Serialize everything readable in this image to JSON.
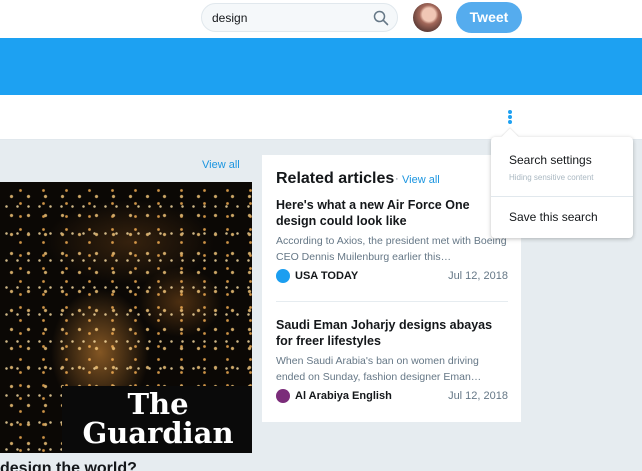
{
  "header": {
    "search_value": "design",
    "tweet_label": "Tweet"
  },
  "menu": {
    "search_settings": "Search settings",
    "search_settings_sub": "Hiding sensitive content",
    "save_search": "Save this search"
  },
  "left_card": {
    "view_all": "View all",
    "image_logo": "The Guardian",
    "headline": "design the world?"
  },
  "related": {
    "title": "Related articles",
    "separator": "·",
    "view_all": "View all",
    "articles": [
      {
        "headline": "Here's what a new Air Force One design could look like",
        "snippet": "According to Axios, the president met with Boeing CEO Dennis Muilenburg earlier this…",
        "source": "USA TODAY",
        "source_color": "#1b9ef0",
        "date": "Jul 12, 2018"
      },
      {
        "headline": "Saudi Eman Joharjy designs abayas for freer lifestyles",
        "snippet": "When Saudi Arabia's ban on women driving ended on Sunday, fashion designer Eman…",
        "source": "Al Arabiya English",
        "source_color": "#7b2d7a",
        "date": "Jul 12, 2018"
      }
    ]
  },
  "colors": {
    "accent": "#1da1f2",
    "link": "#1b95e0",
    "tweet_button": "#55acee"
  }
}
